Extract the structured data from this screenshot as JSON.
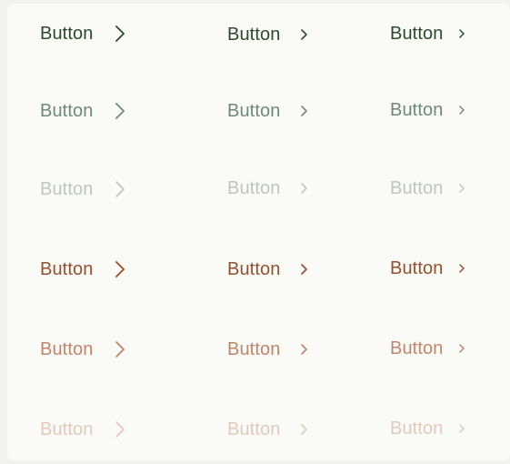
{
  "buttons": {
    "label": "Button",
    "icon": "chevron-right-icon",
    "rows": [
      {
        "variant": "green-default",
        "color": "#2d4a2c"
      },
      {
        "variant": "green-muted",
        "color": "#6f8a78"
      },
      {
        "variant": "green-disabled",
        "color": "#bcc7bf"
      },
      {
        "variant": "brown-default",
        "color": "#94502f"
      },
      {
        "variant": "brown-muted",
        "color": "#c1866a"
      },
      {
        "variant": "brown-disabled",
        "color": "#e3c9bb"
      }
    ],
    "sizes": [
      "large",
      "medium",
      "small"
    ]
  }
}
